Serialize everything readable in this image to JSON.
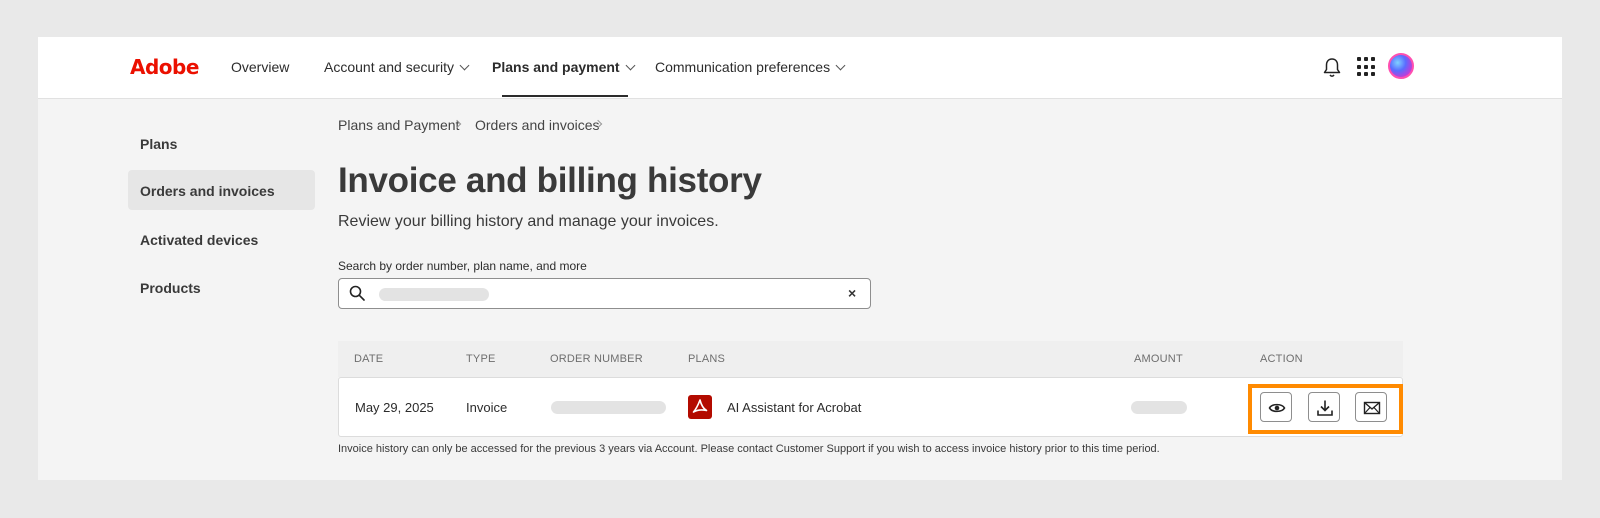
{
  "nav": {
    "logo": "Adobe",
    "items": [
      {
        "label": "Overview"
      },
      {
        "label": "Account and security"
      },
      {
        "label": "Plans and payment"
      },
      {
        "label": "Communication preferences"
      }
    ],
    "active_item": "Plans and payment"
  },
  "header_icons": [
    "bell-icon",
    "apps-grid-icon",
    "avatar"
  ],
  "sidebar": {
    "items": [
      {
        "label": "Plans"
      },
      {
        "label": "Orders and invoices"
      },
      {
        "label": "Activated devices"
      },
      {
        "label": "Products"
      }
    ],
    "active_item": "Orders and invoices"
  },
  "breadcrumb": [
    "Plans and Payment",
    "Orders and invoices"
  ],
  "page": {
    "title": "Invoice and billing history",
    "subtitle": "Review your billing history and manage your invoices."
  },
  "search": {
    "label": "Search by order number, plan name, and more",
    "value": "",
    "clear": "×"
  },
  "table": {
    "columns": [
      "DATE",
      "TYPE",
      "ORDER NUMBER",
      "PLANS",
      "AMOUNT",
      "ACTION"
    ],
    "rows": [
      {
        "date": "May 29, 2025",
        "type": "Invoice",
        "order_number": "",
        "plan": "AI Assistant for Acrobat",
        "plan_icon": "acrobat-pdf-icon",
        "amount": "",
        "actions": [
          "view-eye-icon",
          "download-icon",
          "email-icon"
        ]
      }
    ]
  },
  "footnote": "Invoice history can only be accessed for the previous 3 years via Account. Please contact Customer Support if you wish to access invoice history prior to this time period.",
  "colors": {
    "brand": "#eb1000",
    "highlight": "#ff8a00",
    "pdf": "#b30b00"
  }
}
